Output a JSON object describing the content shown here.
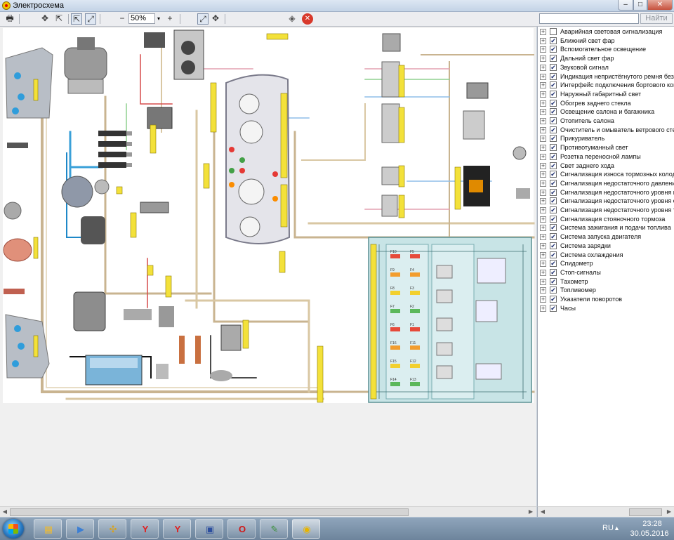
{
  "window": {
    "title": "Электросхема",
    "controls": {
      "minimize": "–",
      "maximize": "□",
      "close": "✕"
    }
  },
  "toolbar": {
    "zoom_value": "50%",
    "zoom_arrow": "▾",
    "icons": {
      "print": "🖶",
      "pan": "✥",
      "select": "⇱",
      "zoom_out": "−",
      "zoom_in": "+",
      "fit": "⤢",
      "move": "✥",
      "erase": "◈",
      "stop": "✕"
    }
  },
  "search": {
    "value": "",
    "button_label": "Найти"
  },
  "systems": [
    {
      "label": "Аварийная световая сигнализация",
      "checked": false
    },
    {
      "label": "Ближний свет фар",
      "checked": true
    },
    {
      "label": "Вспомогательное освещение",
      "checked": true
    },
    {
      "label": "Дальний свет фар",
      "checked": true
    },
    {
      "label": "Звуковой сигнал",
      "checked": true
    },
    {
      "label": "Индикация непристёгнутого ремня безопа",
      "checked": true
    },
    {
      "label": "Интерфейс подключения бортового компь",
      "checked": true
    },
    {
      "label": "Наружный габаритный свет",
      "checked": true
    },
    {
      "label": "Обогрев заднего стекла",
      "checked": true
    },
    {
      "label": "Освещение салона и багажника",
      "checked": true
    },
    {
      "label": "Отопитель салона",
      "checked": true
    },
    {
      "label": "Очиститель и омыватель ветрового стекл",
      "checked": true
    },
    {
      "label": "Прикуриватель",
      "checked": true
    },
    {
      "label": "Противотуманный свет",
      "checked": true
    },
    {
      "label": "Розетка переносной лампы",
      "checked": true
    },
    {
      "label": "Свет заднего хода",
      "checked": true
    },
    {
      "label": "Сигнализация износа тормозных колодок",
      "checked": true
    },
    {
      "label": "Сигнализация недостаточного давления м",
      "checked": true
    },
    {
      "label": "Сигнализация недостаточного уровня мас",
      "checked": true
    },
    {
      "label": "Сигнализация недостаточного уровня охла",
      "checked": true
    },
    {
      "label": "Сигнализация недостаточного уровня торм",
      "checked": true
    },
    {
      "label": "Сигнализация стояночного тормоза",
      "checked": true
    },
    {
      "label": "Система зажигания и подачи топлива",
      "checked": true
    },
    {
      "label": "Система запуска двигателя",
      "checked": true
    },
    {
      "label": "Система зарядки",
      "checked": true
    },
    {
      "label": "Система охлаждения",
      "checked": true
    },
    {
      "label": "Спидометр",
      "checked": true
    },
    {
      "label": "Стоп-сигналы",
      "checked": true
    },
    {
      "label": "Тахометр",
      "checked": true
    },
    {
      "label": "Топливомер",
      "checked": true
    },
    {
      "label": "Указатели поворотов",
      "checked": true
    },
    {
      "label": "Часы",
      "checked": true
    }
  ],
  "fuse_labels": [
    "F10",
    "F5",
    "F9",
    "F4",
    "F8",
    "F3",
    "F7",
    "F2",
    "F6",
    "F1",
    "F16",
    "F11",
    "F15",
    "F12",
    "F14",
    "F13"
  ],
  "taskbar": {
    "apps": [
      {
        "name": "explorer",
        "icon": "▦",
        "color": "#e8b93a"
      },
      {
        "name": "media-player",
        "icon": "▶",
        "color": "#3c7fd4"
      },
      {
        "name": "keys-app",
        "icon": "✣",
        "color": "#d8a21c"
      },
      {
        "name": "yandex-browser",
        "icon": "Y",
        "color": "#e02020"
      },
      {
        "name": "yandex-browser-2",
        "icon": "Y",
        "color": "#e02020"
      },
      {
        "name": "save-app",
        "icon": "▣",
        "color": "#2d4f9e"
      },
      {
        "name": "opera",
        "icon": "O",
        "color": "#d01818"
      },
      {
        "name": "paint",
        "icon": "✎",
        "color": "#3a8f3a"
      },
      {
        "name": "electroschema",
        "icon": "◉",
        "color": "#e7b400"
      }
    ],
    "language": "RU",
    "time": "23:28",
    "date": "30.05.2016"
  }
}
